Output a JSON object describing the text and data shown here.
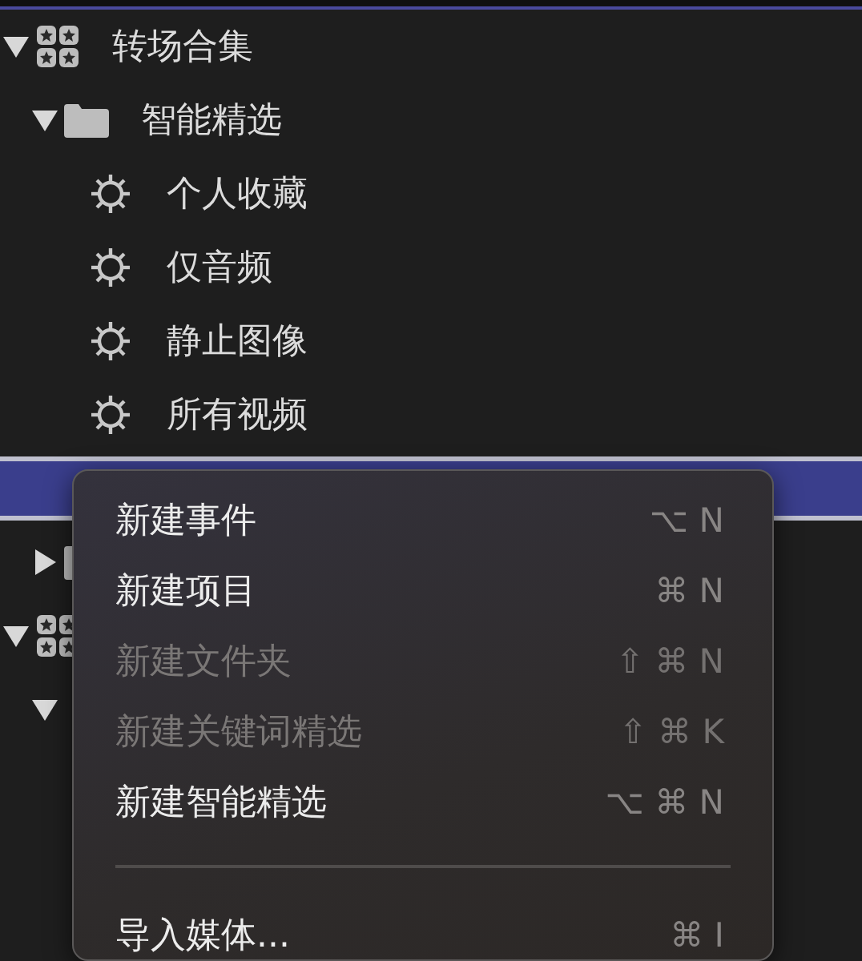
{
  "sidebar": {
    "items": [
      {
        "kind": "library",
        "label": "转场合集",
        "expanded": true,
        "children": [
          {
            "kind": "folder",
            "label": "智能精选",
            "expanded": true,
            "children": [
              {
                "kind": "smart",
                "label": "个人收藏"
              },
              {
                "kind": "smart",
                "label": "仅音频"
              },
              {
                "kind": "smart",
                "label": "静止图像"
              },
              {
                "kind": "smart",
                "label": "所有视频"
              }
            ]
          },
          {
            "selected": true
          },
          {
            "kind": "folder",
            "expanded": false
          }
        ]
      },
      {
        "kind": "library",
        "expanded": true,
        "children": [
          {
            "expanded": true
          }
        ]
      }
    ]
  },
  "context_menu": {
    "items": [
      {
        "kind": "item",
        "label": "新建事件",
        "shortcut": "⌥ N",
        "disabled": false
      },
      {
        "kind": "item",
        "label": "新建项目",
        "shortcut": "⌘ N",
        "disabled": false
      },
      {
        "kind": "item",
        "label": "新建文件夹",
        "shortcut": "⇧ ⌘ N",
        "disabled": true
      },
      {
        "kind": "item",
        "label": "新建关键词精选",
        "shortcut": "⇧ ⌘ K",
        "disabled": true
      },
      {
        "kind": "item",
        "label": "新建智能精选",
        "shortcut": "⌥ ⌘ N",
        "disabled": false
      },
      {
        "kind": "separator"
      },
      {
        "kind": "item",
        "label": "导入媒体...",
        "shortcut": "⌘ I",
        "disabled": false
      }
    ]
  }
}
